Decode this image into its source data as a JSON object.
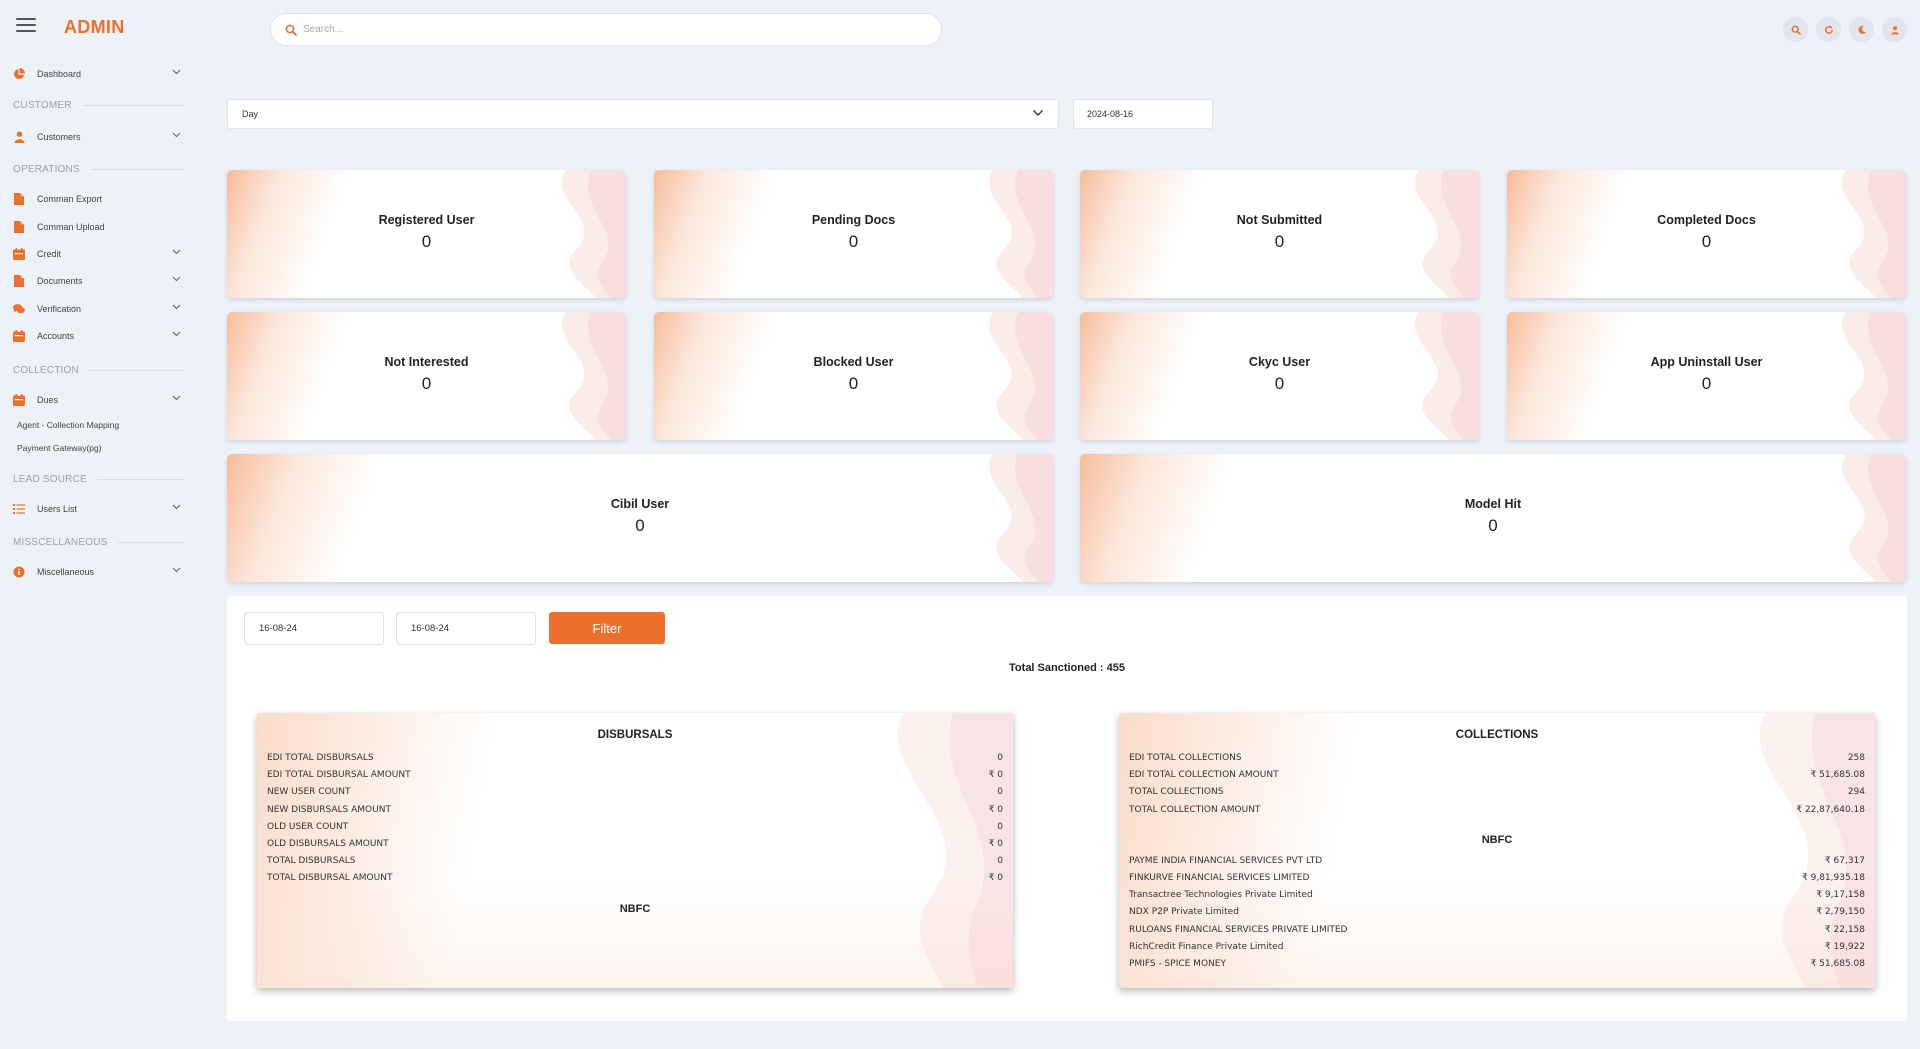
{
  "app": {
    "title": "ADMIN"
  },
  "search": {
    "placeholder": "Search..."
  },
  "sidebar": {
    "items": [
      {
        "label": "Dashboard"
      },
      {
        "section": "CUSTOMER"
      },
      {
        "label": "Customers"
      },
      {
        "section": "OPERATIONS"
      },
      {
        "label": "Comman Export"
      },
      {
        "label": "Comman Upload"
      },
      {
        "label": "Credit"
      },
      {
        "label": "Documents"
      },
      {
        "label": "Verification"
      },
      {
        "label": "Accounts"
      },
      {
        "section": "COLLECTION"
      },
      {
        "label": "Dues"
      },
      {
        "label": "Agent - Collection Mapping"
      },
      {
        "label": "Payment Gateway(pg)"
      },
      {
        "section": "LEAD SOURCE"
      },
      {
        "label": "Users List"
      },
      {
        "section": "MISSCELLANEOUS"
      },
      {
        "label": "Miscellaneous"
      }
    ]
  },
  "filters": {
    "period": "Day",
    "date": "2024-08-16"
  },
  "cards": [
    {
      "title": "Registered User",
      "value": "0"
    },
    {
      "title": "Pending Docs",
      "value": "0"
    },
    {
      "title": "Not Submitted",
      "value": "0"
    },
    {
      "title": "Completed Docs",
      "value": "0"
    },
    {
      "title": "Not Interested",
      "value": "0"
    },
    {
      "title": "Blocked User",
      "value": "0"
    },
    {
      "title": "Ckyc User",
      "value": "0"
    },
    {
      "title": "App Uninstall User",
      "value": "0"
    },
    {
      "title": "Cibil User",
      "value": "0"
    },
    {
      "title": "Model Hit",
      "value": "0"
    }
  ],
  "report": {
    "from_date": "16-08-24",
    "to_date": "16-08-24",
    "filter_label": "Filter",
    "total_sanctioned": "Total Sanctioned : 455",
    "disbursals": {
      "title": "DISBURSALS",
      "rows": [
        {
          "label": "EDI TOTAL DISBURSALS",
          "value": "0"
        },
        {
          "label": "EDI TOTAL DISBURSAL AMOUNT",
          "value": "₹ 0"
        },
        {
          "label": "NEW USER COUNT",
          "value": "0"
        },
        {
          "label": "NEW DISBURSALS AMOUNT",
          "value": "₹ 0"
        },
        {
          "label": "OLD USER COUNT",
          "value": "0"
        },
        {
          "label": "OLD DISBURSALS AMOUNT",
          "value": "₹ 0"
        },
        {
          "label": "TOTAL DISBURSALS",
          "value": "0"
        },
        {
          "label": "TOTAL DISBURSAL AMOUNT",
          "value": "₹ 0"
        }
      ],
      "nbfc_title": "NBFC",
      "nbfc_rows": []
    },
    "collections": {
      "title": "COLLECTIONS",
      "rows": [
        {
          "label": "EDI TOTAL COLLECTIONS",
          "value": "258"
        },
        {
          "label": "EDI TOTAL COLLECTION AMOUNT",
          "value": "₹ 51,685.08"
        },
        {
          "label": "TOTAL COLLECTIONS",
          "value": "294"
        },
        {
          "label": "TOTAL COLLECTION AMOUNT",
          "value": "₹ 22,87,640.18"
        }
      ],
      "nbfc_title": "NBFC",
      "nbfc_rows": [
        {
          "label": "PAYME INDIA FINANCIAL SERVICES PVT LTD",
          "value": "₹ 67,317"
        },
        {
          "label": "FINKURVE FINANCIAL SERVICES LIMITED",
          "value": "₹ 9,81,935.18"
        },
        {
          "label": "Transactree Technologies Private Limited",
          "value": "₹ 9,17,158"
        },
        {
          "label": "NDX P2P Private Limited",
          "value": "₹ 2,79,150"
        },
        {
          "label": "RULOANS FINANCIAL SERVICES PRIVATE LIMITED",
          "value": "₹ 22,158"
        },
        {
          "label": "RichCredit Finance Private Limited",
          "value": "₹ 19,922"
        },
        {
          "label": "PMIFS - SPICE MONEY",
          "value": "₹ 51,685.08"
        }
      ]
    }
  },
  "colors": {
    "accent": "#ec6f2c",
    "background": "#edf1f8",
    "sidebar_icon": "#ec6f2c"
  },
  "icons": {
    "menu": "hamburger-icon",
    "search": "search-icon",
    "refresh": "refresh-icon",
    "theme": "moon-icon",
    "user": "user-icon"
  }
}
